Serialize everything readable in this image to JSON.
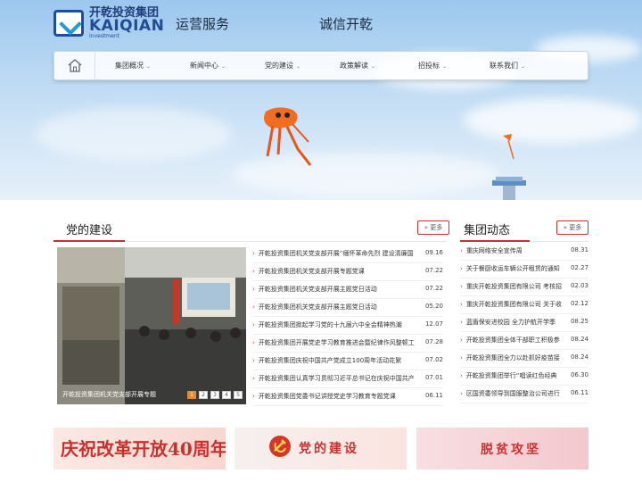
{
  "header": {
    "logo_cn": "开乾投资集团",
    "logo_en": "KAIQIAN",
    "logo_sub": "Investment",
    "slogan_left": "运营服务",
    "slogan_right": "诚信开乾"
  },
  "nav": {
    "items": [
      {
        "label": "集团概况"
      },
      {
        "label": "新闻中心"
      },
      {
        "label": "党的建设"
      },
      {
        "label": "政策解读"
      },
      {
        "label": "招投标"
      },
      {
        "label": "联系我们"
      }
    ]
  },
  "party": {
    "title": "党的建设",
    "more": "更多",
    "photo_caption": "开乾投资集团机关党支部开展专题",
    "slide_pages": [
      "1",
      "2",
      "3",
      "4",
      "5"
    ],
    "news": [
      {
        "title": "开乾投资集团机关党支部开展“缅怀革命先烈 建设清廉国",
        "date": "09.16"
      },
      {
        "title": "开乾投资集团机关党支部开展专题党课",
        "date": "07.22"
      },
      {
        "title": "开乾投资集团机关党支部开展主题党日活动",
        "date": "07.22"
      },
      {
        "title": "开乾投资集团机关党支部开展主题党日活动",
        "date": "05.20"
      },
      {
        "title": "开乾投资集团掀起学习党的十九届六中全会精神热潮",
        "date": "12.07"
      },
      {
        "title": "开乾投资集团开展党史学习教育推进会暨纪律作风整顿工",
        "date": "07.28"
      },
      {
        "title": "开乾投资集团庆祝中国共产党成立100周年活动花絮",
        "date": "07.02"
      },
      {
        "title": "开乾投资集团认真学习贯彻习近平总书记在庆祝中国共产",
        "date": "07.01"
      },
      {
        "title": "开乾投资集团党委书记讲授党史学习教育专题党课",
        "date": "06.11"
      }
    ]
  },
  "dynamics": {
    "title": "集团动态",
    "more": "更多",
    "news": [
      {
        "title": "重庆网络安全宣传周",
        "date": "08.31"
      },
      {
        "title": "关于餐厨收运车辆公开租赁的通知",
        "date": "02.27"
      },
      {
        "title": "重庆开乾投资集团有限公司 考核招",
        "date": "02.03"
      },
      {
        "title": "重庆开乾投资集团有限公司 关于收",
        "date": "02.12"
      },
      {
        "title": "蓝盾保安进校园 全力护航开学季",
        "date": "08.25"
      },
      {
        "title": "开乾投资集团全体干部职工积极参",
        "date": "08.24"
      },
      {
        "title": "开乾投资集团全力以赴抓好疫苗接",
        "date": "08.24"
      },
      {
        "title": "开乾投资集团举行“唱读红色经典",
        "date": "06.30"
      },
      {
        "title": "区国资委领导到国服整治公司进行",
        "date": "06.11"
      }
    ]
  },
  "banners": [
    {
      "text": "庆祝改革开放40周年",
      "color": "#c9312f"
    },
    {
      "text": "党的建设",
      "color": "#c9312f"
    },
    {
      "text": "脱贫攻坚",
      "color": "#c9312f"
    }
  ],
  "colors": {
    "accent": "#c9312f",
    "brand": "#1f4e96"
  }
}
